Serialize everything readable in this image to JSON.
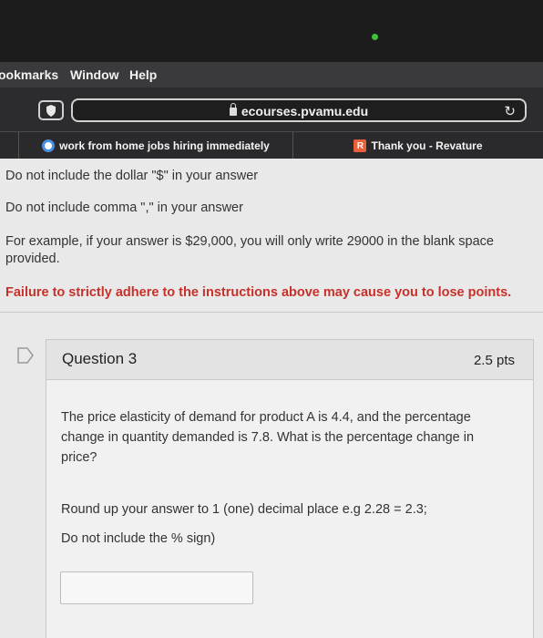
{
  "menubar": {
    "items": [
      "ookmarks",
      "Window",
      "Help"
    ]
  },
  "browser": {
    "url": "ecourses.pvamu.edu",
    "tabs": [
      {
        "label": "work from home jobs hiring immediately"
      },
      {
        "label": "Thank you - Revature",
        "badge": "R"
      }
    ]
  },
  "instructions": {
    "line1": "Do not include the dollar \"$\" in your answer",
    "line2": "Do not include comma \",\" in your answer",
    "example_line1": "For example, if your answer is $29,000, you will only write 29000 in the blank space",
    "example_line2": "provided.",
    "warning": "Failure to strictly adhere to the instructions above may cause you to lose points."
  },
  "question": {
    "title": "Question 3",
    "points": "2.5 pts",
    "text_line1": "The price elasticity of demand for product A is 4.4, and the percentage",
    "text_line2": "change in quantity demanded is 7.8. What is the percentage change in",
    "text_line3": "price?",
    "round_note": "Round up your answer to 1 (one) decimal place  e.g 2.28 = 2.3;",
    "percent_note": "Do not include the % sign)",
    "answer_value": ""
  },
  "colors": {
    "warning": "#c8302a",
    "cam_dot": "#3ec23e",
    "revature": "#e8603c"
  }
}
